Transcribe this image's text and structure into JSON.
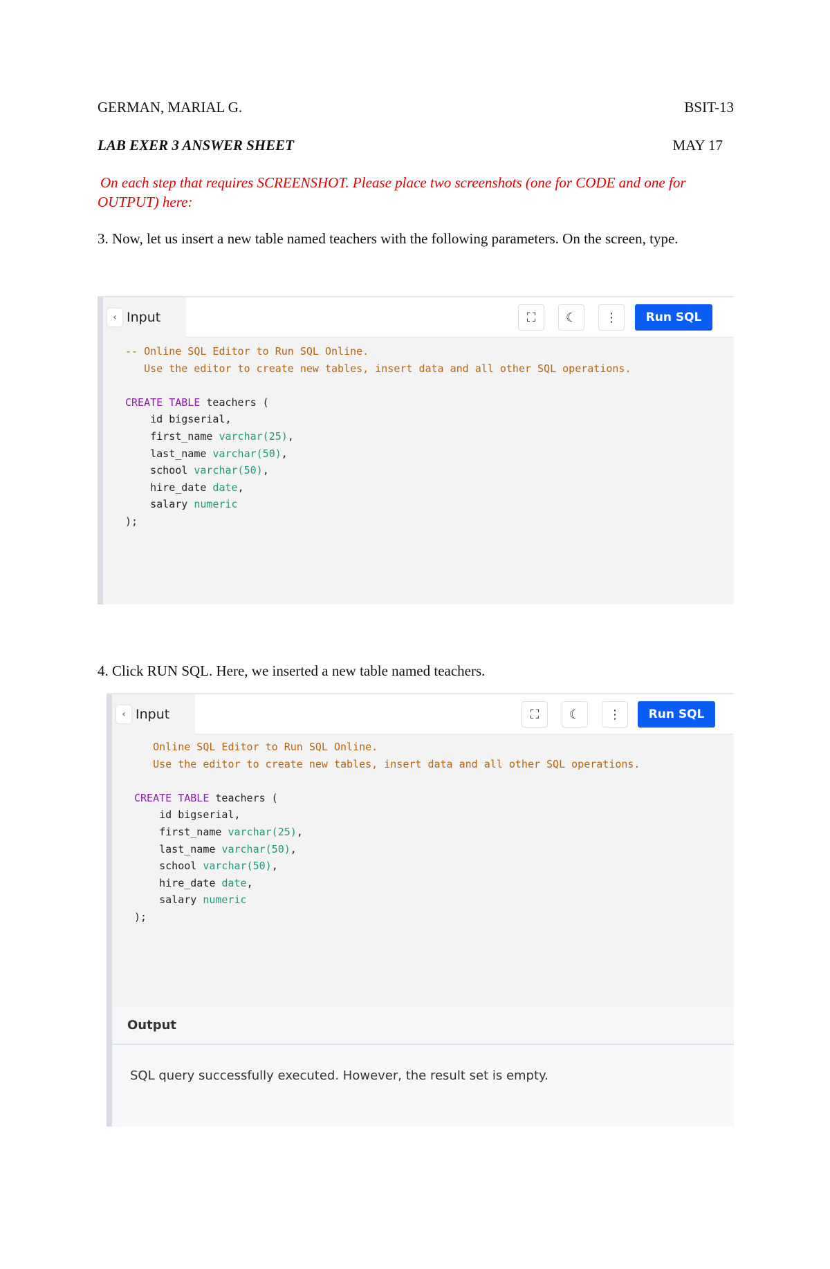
{
  "header": {
    "name": "GERMAN, MARIAL G.",
    "section": "BSIT-13",
    "title": "LAB EXER 3 ANSWER SHEET",
    "date": "MAY 17"
  },
  "instruction": "On each step that requires SCREENSHOT. Please place two screenshots (one for CODE and one for OUTPUT) here:",
  "step3": "3. Now, let us insert a new table named teachers with the following parameters. On the screen, type.",
  "step4": "4. Click RUN SQL. Here, we inserted a new table named teachers.",
  "editor": {
    "tab": "Input",
    "run": "Run SQL",
    "back": "‹",
    "expand": "⛶",
    "theme": "☾",
    "more": "⋮",
    "output_label": "Output",
    "output_text": "SQL query successfully executed. However, the result set is empty."
  },
  "code1": {
    "c1": "-- Online SQL Editor to Run SQL Online.",
    "c2": "   Use the editor to create new tables, insert data and all other SQL operations."
  },
  "code2": {
    "c1": "   Online SQL Editor to Run SQL Online.",
    "c2": "   Use the editor to create new tables, insert data and all other SQL operations."
  },
  "sql": {
    "kw": "CREATE TABLE",
    "name": " teachers (",
    "l1a": "    id bigserial,",
    "l2a": "    first_name ",
    "l2b": "varchar(25)",
    "l3a": "    last_name ",
    "l3b": "varchar(50)",
    "l4a": "    school ",
    "l4b": "varchar(50)",
    "l5a": "    hire_date ",
    "l5b": "date",
    "l6a": "    salary ",
    "l6b": "numeric",
    "end": ");",
    "comma": ","
  }
}
